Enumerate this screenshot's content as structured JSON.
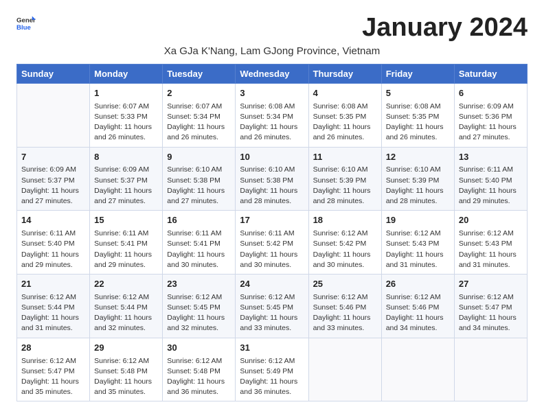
{
  "logo": {
    "general": "General",
    "blue": "Blue"
  },
  "title": "January 2024",
  "subtitle": "Xa GJa K'Nang, Lam GJong Province, Vietnam",
  "days_header": [
    "Sunday",
    "Monday",
    "Tuesday",
    "Wednesday",
    "Thursday",
    "Friday",
    "Saturday"
  ],
  "weeks": [
    [
      {
        "day": "",
        "info": ""
      },
      {
        "day": "1",
        "info": "Sunrise: 6:07 AM\nSunset: 5:33 PM\nDaylight: 11 hours\nand 26 minutes."
      },
      {
        "day": "2",
        "info": "Sunrise: 6:07 AM\nSunset: 5:34 PM\nDaylight: 11 hours\nand 26 minutes."
      },
      {
        "day": "3",
        "info": "Sunrise: 6:08 AM\nSunset: 5:34 PM\nDaylight: 11 hours\nand 26 minutes."
      },
      {
        "day": "4",
        "info": "Sunrise: 6:08 AM\nSunset: 5:35 PM\nDaylight: 11 hours\nand 26 minutes."
      },
      {
        "day": "5",
        "info": "Sunrise: 6:08 AM\nSunset: 5:35 PM\nDaylight: 11 hours\nand 26 minutes."
      },
      {
        "day": "6",
        "info": "Sunrise: 6:09 AM\nSunset: 5:36 PM\nDaylight: 11 hours\nand 27 minutes."
      }
    ],
    [
      {
        "day": "7",
        "info": "Sunrise: 6:09 AM\nSunset: 5:37 PM\nDaylight: 11 hours\nand 27 minutes."
      },
      {
        "day": "8",
        "info": "Sunrise: 6:09 AM\nSunset: 5:37 PM\nDaylight: 11 hours\nand 27 minutes."
      },
      {
        "day": "9",
        "info": "Sunrise: 6:10 AM\nSunset: 5:38 PM\nDaylight: 11 hours\nand 27 minutes."
      },
      {
        "day": "10",
        "info": "Sunrise: 6:10 AM\nSunset: 5:38 PM\nDaylight: 11 hours\nand 28 minutes."
      },
      {
        "day": "11",
        "info": "Sunrise: 6:10 AM\nSunset: 5:39 PM\nDaylight: 11 hours\nand 28 minutes."
      },
      {
        "day": "12",
        "info": "Sunrise: 6:10 AM\nSunset: 5:39 PM\nDaylight: 11 hours\nand 28 minutes."
      },
      {
        "day": "13",
        "info": "Sunrise: 6:11 AM\nSunset: 5:40 PM\nDaylight: 11 hours\nand 29 minutes."
      }
    ],
    [
      {
        "day": "14",
        "info": "Sunrise: 6:11 AM\nSunset: 5:40 PM\nDaylight: 11 hours\nand 29 minutes."
      },
      {
        "day": "15",
        "info": "Sunrise: 6:11 AM\nSunset: 5:41 PM\nDaylight: 11 hours\nand 29 minutes."
      },
      {
        "day": "16",
        "info": "Sunrise: 6:11 AM\nSunset: 5:41 PM\nDaylight: 11 hours\nand 30 minutes."
      },
      {
        "day": "17",
        "info": "Sunrise: 6:11 AM\nSunset: 5:42 PM\nDaylight: 11 hours\nand 30 minutes."
      },
      {
        "day": "18",
        "info": "Sunrise: 6:12 AM\nSunset: 5:42 PM\nDaylight: 11 hours\nand 30 minutes."
      },
      {
        "day": "19",
        "info": "Sunrise: 6:12 AM\nSunset: 5:43 PM\nDaylight: 11 hours\nand 31 minutes."
      },
      {
        "day": "20",
        "info": "Sunrise: 6:12 AM\nSunset: 5:43 PM\nDaylight: 11 hours\nand 31 minutes."
      }
    ],
    [
      {
        "day": "21",
        "info": "Sunrise: 6:12 AM\nSunset: 5:44 PM\nDaylight: 11 hours\nand 31 minutes."
      },
      {
        "day": "22",
        "info": "Sunrise: 6:12 AM\nSunset: 5:44 PM\nDaylight: 11 hours\nand 32 minutes."
      },
      {
        "day": "23",
        "info": "Sunrise: 6:12 AM\nSunset: 5:45 PM\nDaylight: 11 hours\nand 32 minutes."
      },
      {
        "day": "24",
        "info": "Sunrise: 6:12 AM\nSunset: 5:45 PM\nDaylight: 11 hours\nand 33 minutes."
      },
      {
        "day": "25",
        "info": "Sunrise: 6:12 AM\nSunset: 5:46 PM\nDaylight: 11 hours\nand 33 minutes."
      },
      {
        "day": "26",
        "info": "Sunrise: 6:12 AM\nSunset: 5:46 PM\nDaylight: 11 hours\nand 34 minutes."
      },
      {
        "day": "27",
        "info": "Sunrise: 6:12 AM\nSunset: 5:47 PM\nDaylight: 11 hours\nand 34 minutes."
      }
    ],
    [
      {
        "day": "28",
        "info": "Sunrise: 6:12 AM\nSunset: 5:47 PM\nDaylight: 11 hours\nand 35 minutes."
      },
      {
        "day": "29",
        "info": "Sunrise: 6:12 AM\nSunset: 5:48 PM\nDaylight: 11 hours\nand 35 minutes."
      },
      {
        "day": "30",
        "info": "Sunrise: 6:12 AM\nSunset: 5:48 PM\nDaylight: 11 hours\nand 36 minutes."
      },
      {
        "day": "31",
        "info": "Sunrise: 6:12 AM\nSunset: 5:49 PM\nDaylight: 11 hours\nand 36 minutes."
      },
      {
        "day": "",
        "info": ""
      },
      {
        "day": "",
        "info": ""
      },
      {
        "day": "",
        "info": ""
      }
    ]
  ]
}
